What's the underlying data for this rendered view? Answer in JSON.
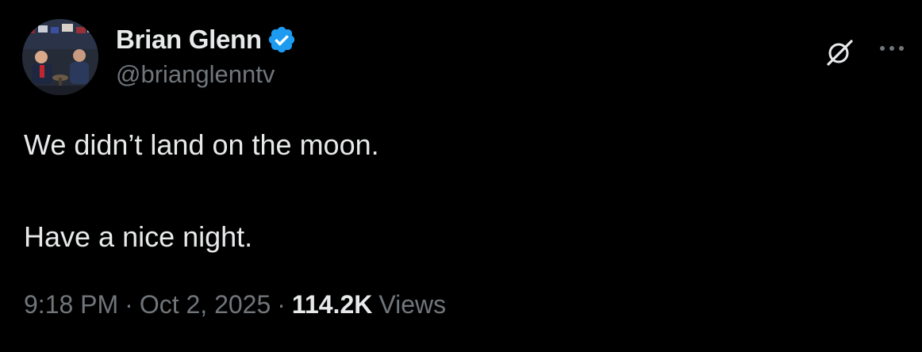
{
  "author": {
    "display_name": "Brian Glenn",
    "handle": "@brianglenntv",
    "verified": true,
    "verified_color": "#1d9bf0"
  },
  "tweet": {
    "lines": [
      "We didn’t land on the moon.",
      "Have a nice night."
    ]
  },
  "meta": {
    "time": "9:18 PM",
    "separator": "·",
    "date": "Oct 2, 2025",
    "views_count": "114.2K",
    "views_label": "Views"
  },
  "icons": {
    "grok": "grok-icon",
    "more": "more-icon",
    "verified": "verified-badge-icon"
  },
  "colors": {
    "background": "#000000",
    "primary_text": "#e7e9ea",
    "secondary_text": "#71767b",
    "accent": "#1d9bf0"
  }
}
